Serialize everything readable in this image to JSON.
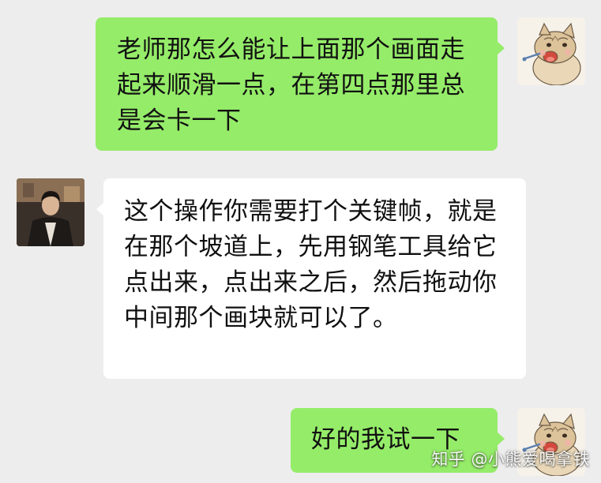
{
  "conversation": {
    "messages": [
      {
        "sender": "me",
        "text": "老师那怎么能让上面那个画面走起来顺滑一点，在第四点那里总是会卡一下"
      },
      {
        "sender": "other",
        "text": "这个操作你需要打个关键帧，就是在那个坡道上，先用钢笔工具给它点出来，点出来之后，然后拖动你中间那个画块就可以了。"
      },
      {
        "sender": "me",
        "text": "好的我试一下"
      }
    ]
  },
  "watermark": {
    "text": "知乎 @小熊爱喝拿铁"
  },
  "colors": {
    "background": "#ededed",
    "my_bubble": "#95ec69",
    "other_bubble": "#ffffff"
  }
}
